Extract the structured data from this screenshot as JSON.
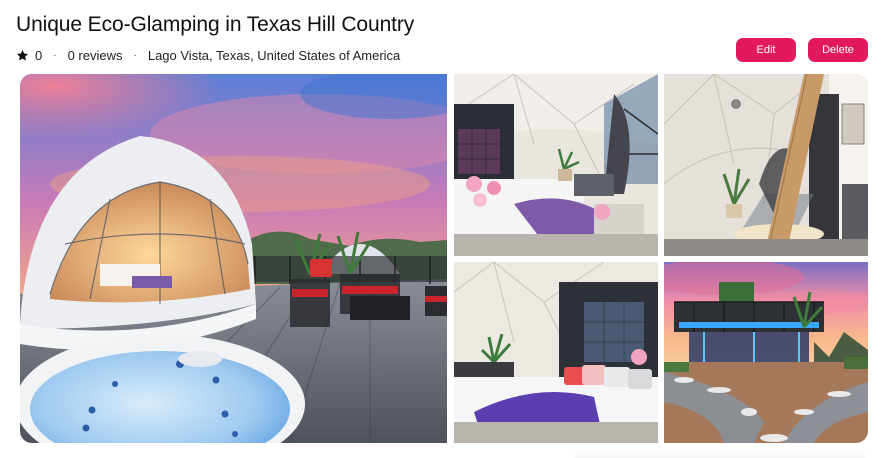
{
  "listing": {
    "title": "Unique Eco-Glamping in Texas Hill Country",
    "rating": "0",
    "reviews": "0 reviews",
    "location": "Lago Vista, Texas, United States of America",
    "separator": "·"
  },
  "actions": {
    "edit_label": "Edit",
    "delete_label": "Delete"
  },
  "icons": {
    "rating": "star-icon"
  },
  "colors": {
    "accent": "#e21a5c",
    "text": "#222222"
  },
  "photos": [
    {
      "name": "glamping-dome-deck-hot-tub-photo"
    },
    {
      "name": "dome-bedroom-interior-photo"
    },
    {
      "name": "dome-interior-window-photo"
    },
    {
      "name": "dome-bedroom-pillows-photo"
    },
    {
      "name": "deck-night-lights-garden-photo"
    }
  ]
}
